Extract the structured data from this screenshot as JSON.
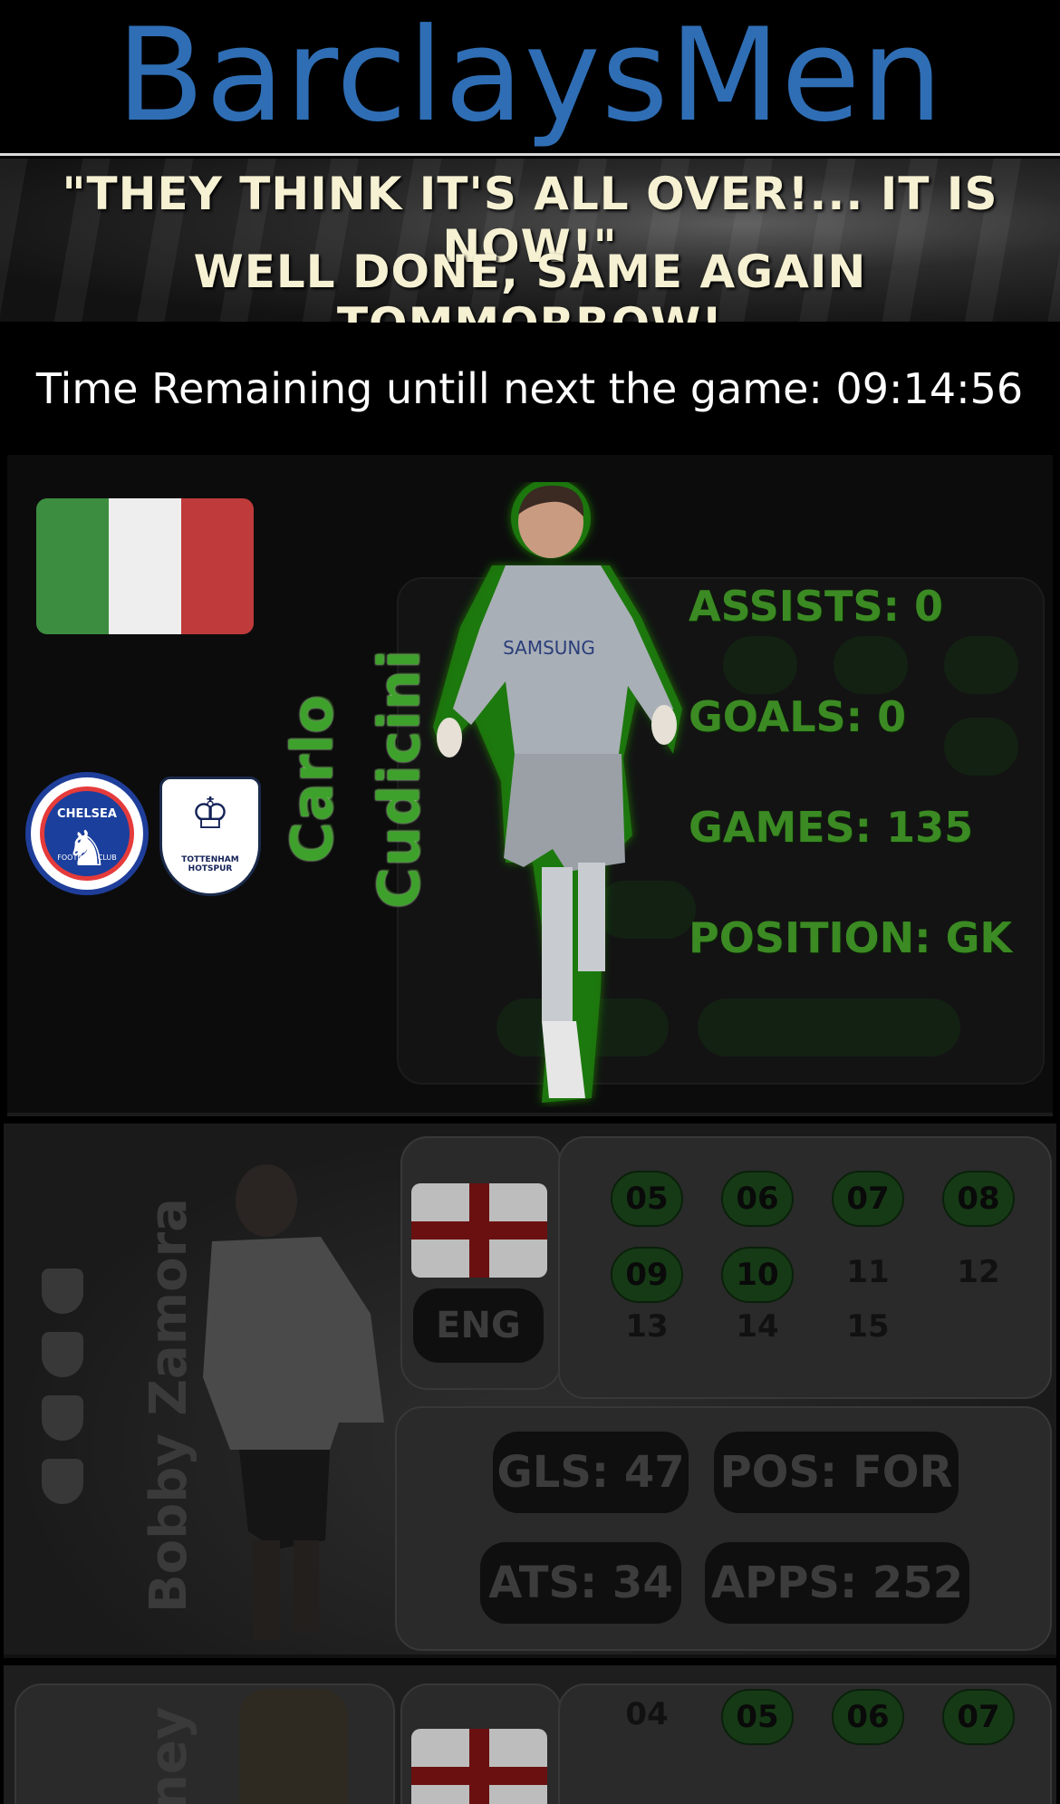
{
  "header": {
    "brand": "BarclaysMen"
  },
  "banner": {
    "line1": "\"They think it's all over!... It is now!\"",
    "line2": "Well Done, same again tommorrow!"
  },
  "timer": {
    "text": "Time Remaining untill next the game: 09:14:56"
  },
  "featured_player": {
    "first_name": "Carlo",
    "last_name": "Cudicini",
    "nationality_flag": "italy-flag",
    "clubs": [
      "chelsea-crest",
      "tottenham-crest"
    ],
    "stats": {
      "assists": "Assists: 0",
      "goals": "Goals: 0",
      "games": "Games: 135",
      "position": "Position: GK"
    },
    "colors": {
      "stat_green": "#3b8a23",
      "name_green": "#3ea12c",
      "brand_blue": "#2f6eb5"
    },
    "chelsea_text_top": "CHELSEA",
    "chelsea_text_bottom": "FOOTBALL CLUB",
    "spurs_text": "TOTTENHAM HOTSPUR"
  },
  "next_card": {
    "name": "Bobby Zamora",
    "country": "ENG",
    "seasons_highlighted": [
      "05",
      "06",
      "07",
      "08",
      "09",
      "10"
    ],
    "seasons_other": [
      "11",
      "12",
      "13",
      "14",
      "15"
    ],
    "stats": {
      "goals": "GLS: 47",
      "position": "POS: FOR",
      "assists": "ATS: 34",
      "apps": "APPS: 252"
    }
  },
  "third_card": {
    "name_fragment": "ney",
    "seasons": [
      "04",
      "05",
      "06",
      "07"
    ]
  }
}
